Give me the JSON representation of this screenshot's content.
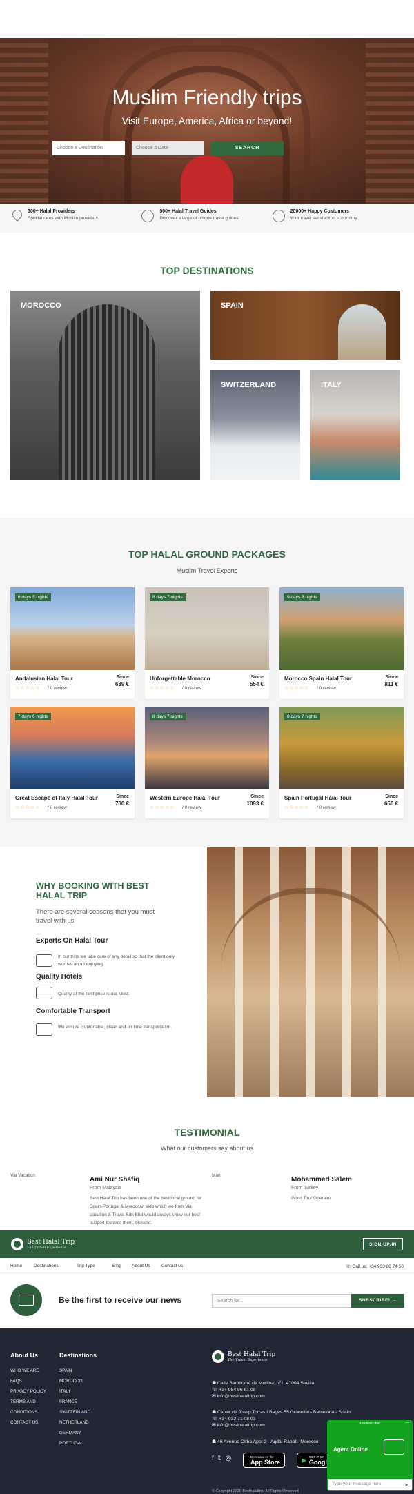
{
  "hero": {
    "title": "Muslim Friendly trips",
    "subtitle": "Visit Europe, America, Africa or beyond!",
    "destination_placeholder": "Choose a Destination",
    "date_placeholder": "Choose a Date",
    "search_label": "SEARCH"
  },
  "features": [
    {
      "title": "300+ Halal Providers",
      "desc": "Special rates with Muslim providers",
      "icon": "location-pin-icon"
    },
    {
      "title": "500+ Halal Travel Guides",
      "desc": "Discover a large of unique travel guides",
      "icon": "user-guide-icon"
    },
    {
      "title": "20000+ Happy Customers",
      "desc": "Your travel satisfaction is our duty",
      "icon": "smiley-icon"
    }
  ],
  "destinations": {
    "title": "TOP DESTINATIONS",
    "items": [
      {
        "label": "MOROCCO"
      },
      {
        "label": "SPAIN"
      },
      {
        "label": "SWITZERLAND"
      },
      {
        "label": "ITALY"
      }
    ]
  },
  "packages": {
    "title": "TOP HALAL GROUND PACKAGES",
    "subtitle": "Muslim Travel Experts",
    "since_label": "Since",
    "items": [
      {
        "badge": "6 days 5 nights",
        "name": "Andalusian Halal Tour",
        "price": "639 €",
        "reviews": "/ 0 review",
        "stars": "☆☆☆☆☆"
      },
      {
        "badge": "8 days 7 nights",
        "name": "Unforgettable Morocco",
        "price": "554 €",
        "reviews": "/ 0 review",
        "stars": "☆☆☆☆☆"
      },
      {
        "badge": "9 days 8 nights",
        "name": "Morocco Spain Halal Tour",
        "price": "811 €",
        "reviews": "/ 0 review",
        "stars": "☆☆☆☆☆"
      },
      {
        "badge": "7 days 6 nights",
        "name": "Great Escape of Italy Halal Tour",
        "price": "700 €",
        "reviews": "/ 0 review",
        "stars": "☆☆☆☆☆"
      },
      {
        "badge": "8 days 7 nights",
        "name": "Western Europe Halal Tour",
        "price": "1093 €",
        "reviews": "/ 0 review",
        "stars": "☆☆☆☆☆"
      },
      {
        "badge": "8 days 7 nights",
        "name": "Spain Portugal Halal Tour",
        "price": "650 €",
        "reviews": "/ 0 review",
        "stars": "☆☆☆☆☆"
      }
    ]
  },
  "why": {
    "title": "WHY BOOKING WITH BEST HALAL TRIP",
    "lead": "There are several seasons that you must travel with us",
    "items": [
      {
        "heading": "Experts On Halal Tour",
        "text": "In our trips we take care of any detail so that the client only worries about enjoying.",
        "icon": "experts-icon"
      },
      {
        "heading": "Quality Hotels",
        "text": "Quality at the best price is our Must.",
        "icon": "hotel-icon"
      },
      {
        "heading": "Comfortable Transport",
        "text": "We assure comfortable, clean and on time transportation.",
        "icon": "car-icon"
      }
    ]
  },
  "testimonial": {
    "title": "TESTIMONIAL",
    "subtitle": "What our customers say about us",
    "left_label": "Via Vacation",
    "mid_label": "Man",
    "items": [
      {
        "name": "Ami Nur Shafiq",
        "from": "From Malaysia",
        "quote": "Best Halal Trip has been one of the best local ground for Spain-Portugal & Moroccan side which we from Via Vacation & Travel Sdn Bhd would always show our best support towards them, blessed."
      },
      {
        "name": "Mohammed Salem",
        "from": "From Turkey",
        "quote": "Good Tour Operator"
      }
    ]
  },
  "brand": {
    "name": "Best Halal Trip",
    "tagline": "The Travel Experience",
    "signup": "SIGN UP/IN"
  },
  "nav": {
    "items": [
      "Home",
      "Destinations",
      "Trip Type",
      "Blog",
      "About Us",
      "Contact us"
    ],
    "call": "☏ Call us: +34 933 88 74 50"
  },
  "newsletter": {
    "headline": "Be the first to receive our news",
    "placeholder": "Search for...",
    "button": "SUBSCRIBE! →"
  },
  "footer": {
    "about_title": "About Us",
    "about_items": [
      "WHO WE ARE",
      "FAQS",
      "PRIVACY POLICY",
      "TERMS AND",
      "CONDITIONS",
      "CONTACT US"
    ],
    "dest_title": "Destinations",
    "dest_items": [
      "SPAIN",
      "MOROCCO",
      "ITALY",
      "FRANCE",
      "SWITZERLAND",
      "NETHERLAND",
      "GERMANY",
      "PORTUGAL"
    ],
    "offices": [
      {
        "address": "☗ Calle Bartolomé de Medina, nº1, 41004 Sevilla",
        "phone": "☏ +34 954 96 61 08",
        "email": "✉ info@besthalaltrip.com"
      },
      {
        "address": "☗ Carrer de Josep Torras I Bages 55 Granollers Barcelona - Spain",
        "phone": "☏ +34 932 71 08 03",
        "email": "✉ info@besthalaltrip.com"
      }
    ],
    "office3": "☗ 46 Avenue Okba Appt 2 - Agdal Rabat - Morocco",
    "appstore_small": "Download on the",
    "appstore_big": "App Store",
    "gplay_small": "GET IT ON",
    "gplay_big": "Google Play",
    "copyright": "© Copyright 2020 Besthalaltrip. All Rights Reserved"
  },
  "chat": {
    "header": "zendesk chat",
    "status": "Agent Online",
    "placeholder": "Type your message here"
  }
}
